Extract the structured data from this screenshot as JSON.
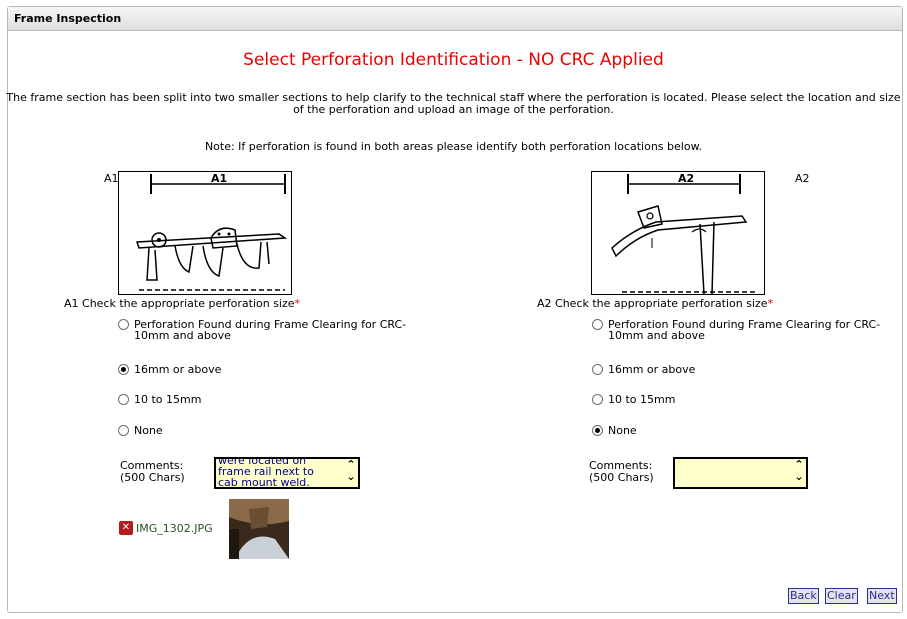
{
  "panel": {
    "title": "Frame Inspection"
  },
  "heading": "Select Perforation Identification - NO CRC Applied",
  "intro": "The frame section has been split into two smaller sections to help clarify to the technical staff where the perforation is located. Please select the location and size of the perforation and upload an image of the perforation.",
  "note": "Note: If perforation is found in both areas please identify both perforation locations below.",
  "sections": [
    {
      "id": "A1",
      "diagram_label": "A1",
      "tag": "A1",
      "check_label": "A1  Check the appropriate perforation size",
      "required_mark": "*",
      "options": [
        "Perforation Found during Frame Clearing for CRC-10mm and above",
        "16mm or above",
        "10 to 15mm",
        "None"
      ],
      "selected": 1,
      "comments_label": "Comments:\n(500 Chars)",
      "comment_value": "were located on\nframe rail next to\ncab mount weld.",
      "attachment": {
        "filename": "IMG_1302.JPG",
        "delete_icon": "delete-x-icon"
      }
    },
    {
      "id": "A2",
      "diagram_label": "A2",
      "tag": "A2",
      "check_label": "A2  Check the appropriate perforation size",
      "required_mark": "*",
      "options": [
        "Perforation Found during Frame Clearing for CRC-10mm and above",
        "16mm or above",
        "10 to 15mm",
        "None"
      ],
      "selected": 3,
      "comments_label": "Comments:\n(500 Chars)",
      "comment_value": ""
    }
  ],
  "scroll_up": "⌃",
  "scroll_down": "⌄",
  "buttons": {
    "back": "Back",
    "clear": "Clear",
    "next": "Next"
  },
  "colors": {
    "heading": "#ee0000",
    "comment_bg": "#ffffcc",
    "button_text": "#2d2d8a"
  }
}
